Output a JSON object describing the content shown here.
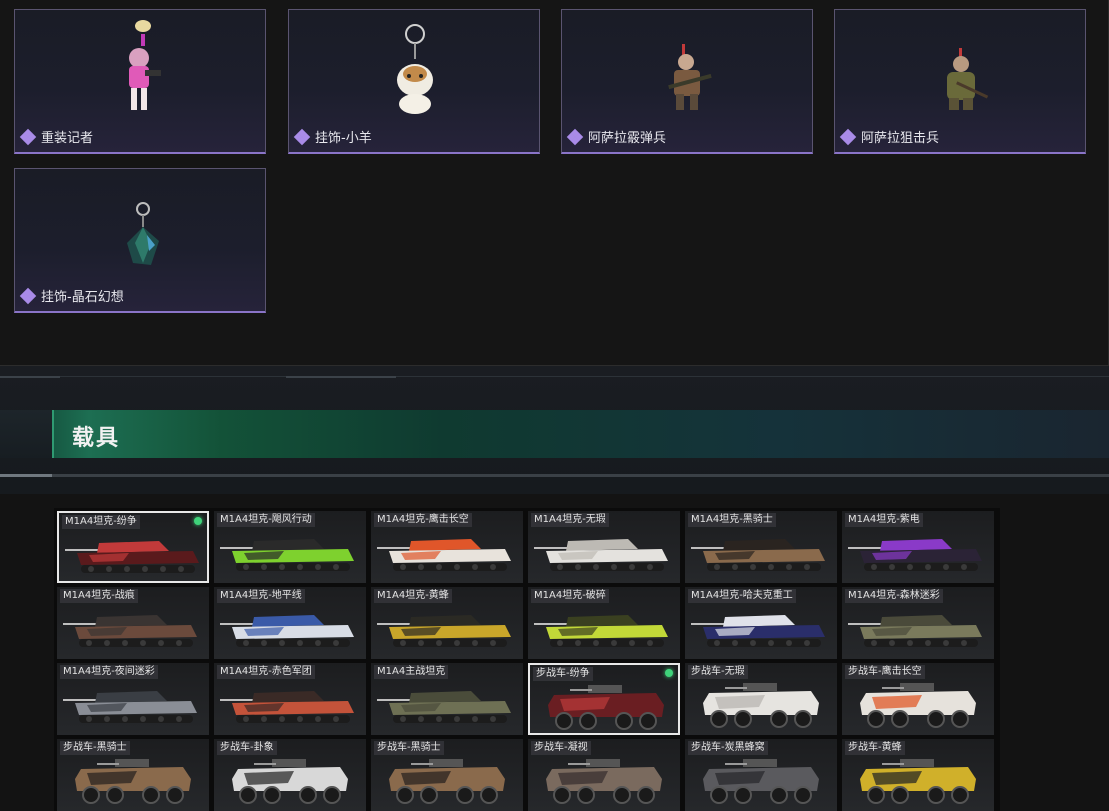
{
  "items": [
    {
      "name": "重装记者",
      "art": "figure-pink"
    },
    {
      "name": "挂饰-小羊",
      "art": "charm-sheep"
    },
    {
      "name": "阿萨拉霰弹兵",
      "art": "figure-soldier-red"
    },
    {
      "name": "阿萨拉狙击兵",
      "art": "figure-soldier-green"
    },
    {
      "name": "挂饰-晶石幻想",
      "art": "charm-crystal"
    }
  ],
  "section": {
    "title": "载具"
  },
  "vehicles": [
    {
      "label": "M1A4坦克-纷争",
      "type": "tank",
      "colors": [
        "#5a1a1c",
        "#c23a3a"
      ],
      "selected": true,
      "equipped": true
    },
    {
      "label": "M1A4坦克-飓风行动",
      "type": "tank",
      "colors": [
        "#7ed12e",
        "#2a2a2a"
      ]
    },
    {
      "label": "M1A4坦克-鹰击长空",
      "type": "tank",
      "colors": [
        "#e8e3dc",
        "#e0562a"
      ]
    },
    {
      "label": "M1A4坦克-无瑕",
      "type": "tank",
      "colors": [
        "#e4e2de",
        "#bdbab4"
      ]
    },
    {
      "label": "M1A4坦克-黑骑士",
      "type": "tank",
      "colors": [
        "#8a6a4c",
        "#2a2420"
      ]
    },
    {
      "label": "M1A4坦克-紫电",
      "type": "tank",
      "colors": [
        "#2b2336",
        "#8a3ac8"
      ]
    },
    {
      "label": "M1A4坦克-战痕",
      "type": "tank",
      "colors": [
        "#6b4a3c",
        "#3a3432"
      ]
    },
    {
      "label": "M1A4坦克-地平线",
      "type": "tank",
      "colors": [
        "#d8dde6",
        "#3a5aa8"
      ]
    },
    {
      "label": "M1A4坦克-黄蜂",
      "type": "tank",
      "colors": [
        "#c9a62a",
        "#2b2a24"
      ]
    },
    {
      "label": "M1A4坦克-破碎",
      "type": "tank",
      "colors": [
        "#c2d838",
        "#3a4020"
      ]
    },
    {
      "label": "M1A4坦克-哈夫克重工",
      "type": "tank",
      "colors": [
        "#2a2e6a",
        "#e0e2ea"
      ]
    },
    {
      "label": "M1A4坦克-森林迷彩",
      "type": "tank",
      "colors": [
        "#7a7a5c",
        "#4a4a3a"
      ]
    },
    {
      "label": "M1A4坦克-夜间迷彩",
      "type": "tank",
      "colors": [
        "#8a8e96",
        "#3a3e44"
      ]
    },
    {
      "label": "M1A4坦克-赤色军团",
      "type": "tank",
      "colors": [
        "#c4533a",
        "#3a2a26"
      ]
    },
    {
      "label": "M1A4主战坦克",
      "type": "tank",
      "colors": [
        "#6e7054",
        "#4a4c3a"
      ]
    },
    {
      "label": "步战车-纷争",
      "type": "ifv",
      "colors": [
        "#6a1e22",
        "#b83a3a"
      ],
      "selected": true,
      "equipped": true
    },
    {
      "label": "步战车-无瑕",
      "type": "ifv",
      "colors": [
        "#e6e4e0",
        "#b8b6b2"
      ]
    },
    {
      "label": "步战车-鹰击长空",
      "type": "ifv",
      "colors": [
        "#e6e2dc",
        "#e05a2a"
      ]
    },
    {
      "label": "步战车-黑骑士",
      "type": "ifv",
      "colors": [
        "#8a6a4c",
        "#2a2420"
      ]
    },
    {
      "label": "步战车-卦象",
      "type": "ifv",
      "colors": [
        "#d8d8d8",
        "#2e2e2e"
      ]
    },
    {
      "label": "步战车-黑骑士",
      "type": "ifv",
      "colors": [
        "#8a6a4c",
        "#2a2420"
      ]
    },
    {
      "label": "步战车-凝视",
      "type": "ifv",
      "colors": [
        "#7a6a5e",
        "#3a3030"
      ]
    },
    {
      "label": "步战车-炭黑蜂窝",
      "type": "ifv",
      "colors": [
        "#5a5a5e",
        "#2a2a2e"
      ]
    },
    {
      "label": "步战车-黄蜂",
      "type": "ifv",
      "colors": [
        "#d0b02a",
        "#2a2a24"
      ]
    }
  ]
}
